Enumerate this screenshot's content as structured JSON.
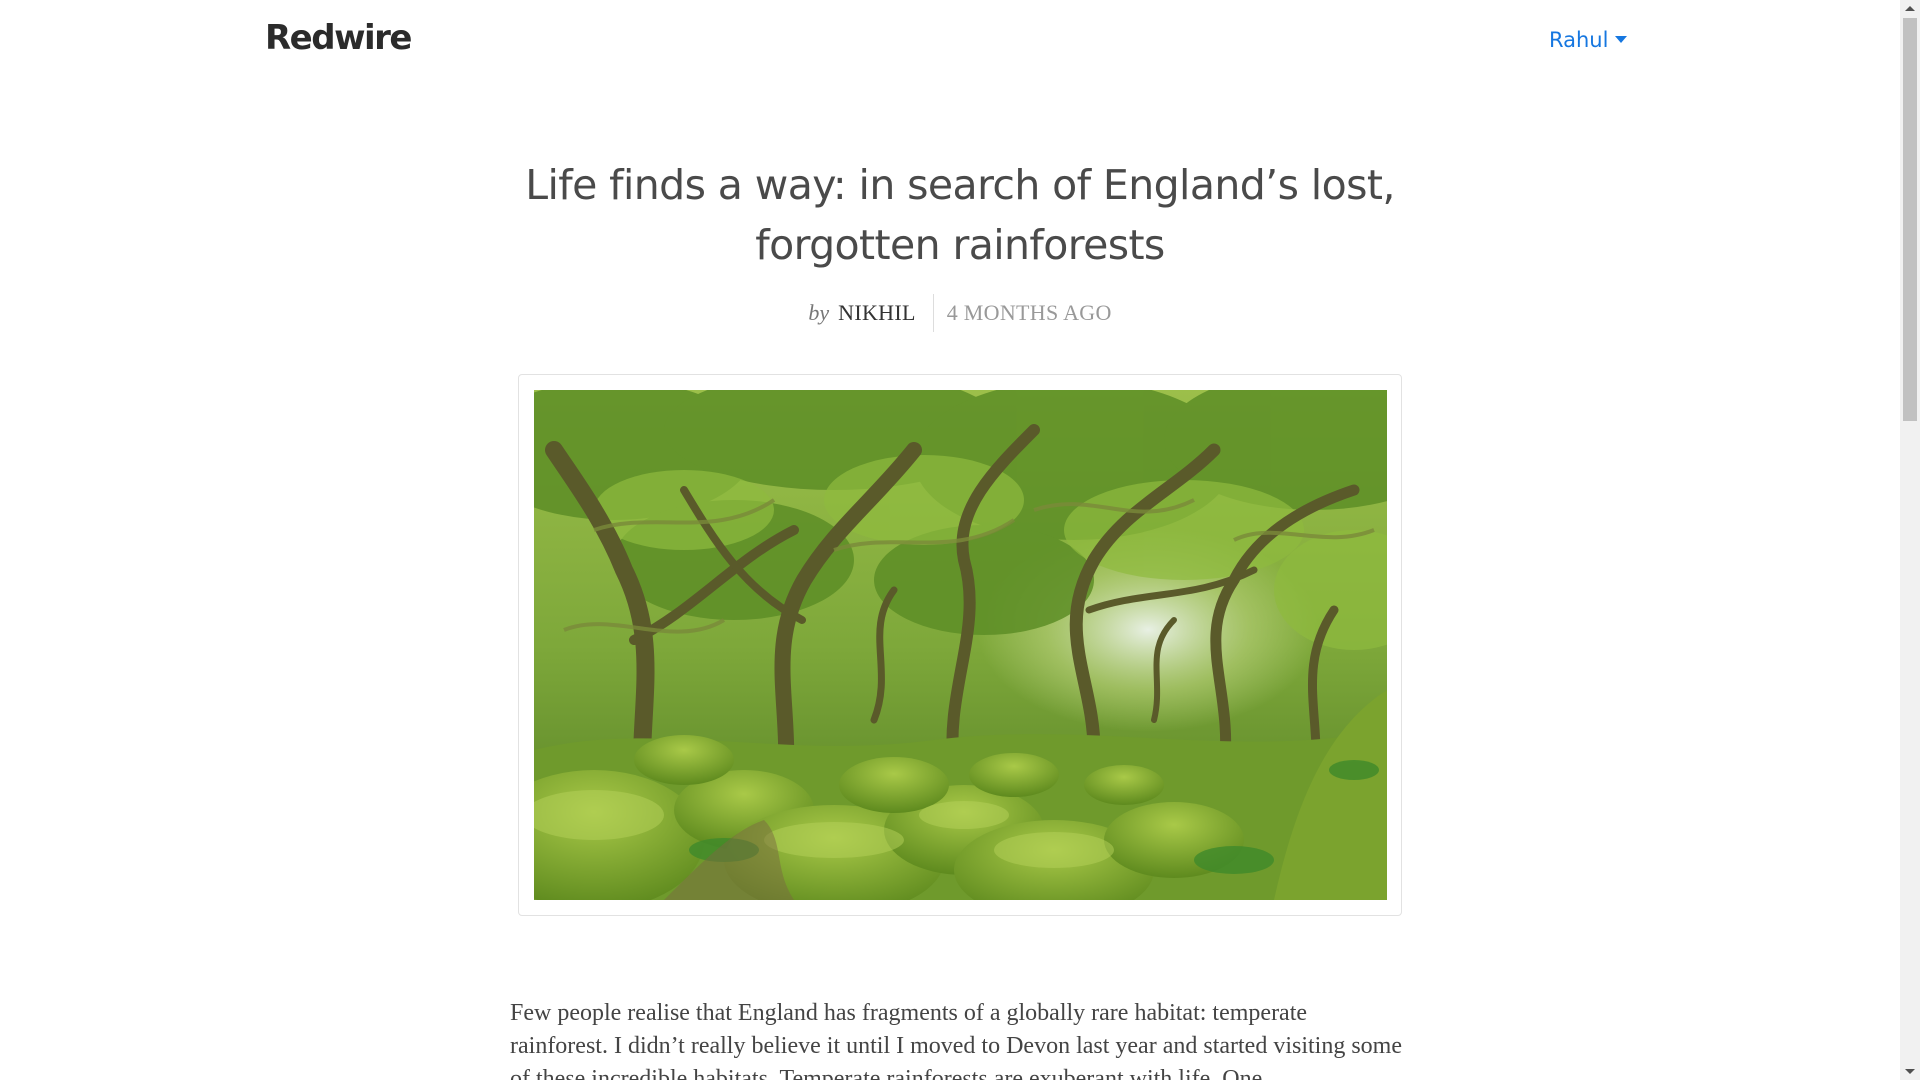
{
  "header": {
    "brand": "Redwire",
    "user_menu_label": "Rahul"
  },
  "article": {
    "title": "Life finds a way: in search of England’s lost, forgotten rainforests",
    "byline_prefix": "by",
    "author": "NIKHIL",
    "published": "4 MONTHS AGO",
    "hero_image_icon": "mossy-forest-photo",
    "body_first_paragraph": "Few people realise that England has fragments of a globally rare habitat: temperate rainforest. I didn’t really believe it until I moved to Devon last year and started visiting some of these incredible habitats. Temperate rainforests are exuberant with life. One"
  },
  "colors": {
    "accent_link": "#1677e0",
    "title_text": "#4a4a4a",
    "body_text": "#444444",
    "muted_text": "#999999"
  },
  "icons": {
    "user_menu_caret": "caret-down-icon",
    "scroll_up": "arrow-up-icon",
    "scroll_down": "arrow-down-icon"
  }
}
